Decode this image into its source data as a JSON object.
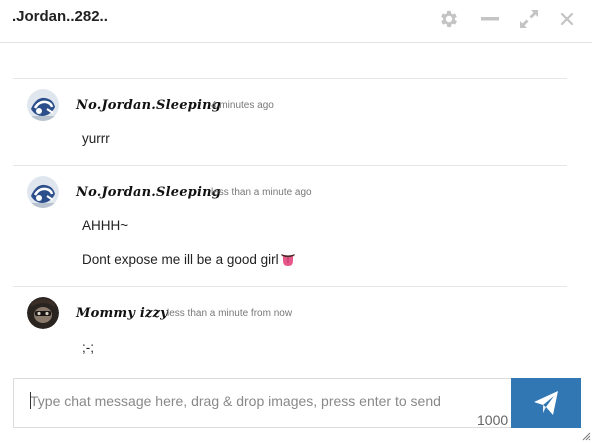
{
  "header": {
    "title": ".Jordan..282..",
    "icons": [
      "gear-icon",
      "minimize-icon",
      "expand-icon",
      "close-icon"
    ]
  },
  "messages": [
    {
      "username": "No.Jordan.Sleeping",
      "timestamp": "4 minutes ago",
      "lines": [
        "yurrr"
      ]
    },
    {
      "username": "No.Jordan.Sleeping",
      "timestamp": "less than a minute ago",
      "lines": [
        "AHHH~",
        "Dont expose me ill be a good girl"
      ],
      "emoji": "tongue-emoji"
    },
    {
      "username": "Mommy izzy",
      "timestamp": "less than a minute from now",
      "lines": [
        ";-;"
      ]
    }
  ],
  "composer": {
    "placeholder": "Type chat message here, drag & drop images, press enter to send",
    "value": "",
    "char_counter": "1000",
    "send_icon": "send-icon"
  },
  "colors": {
    "send_button": "#3177b4",
    "icon_gray": "#c4c4c4",
    "separator": "#e6e6e6"
  }
}
